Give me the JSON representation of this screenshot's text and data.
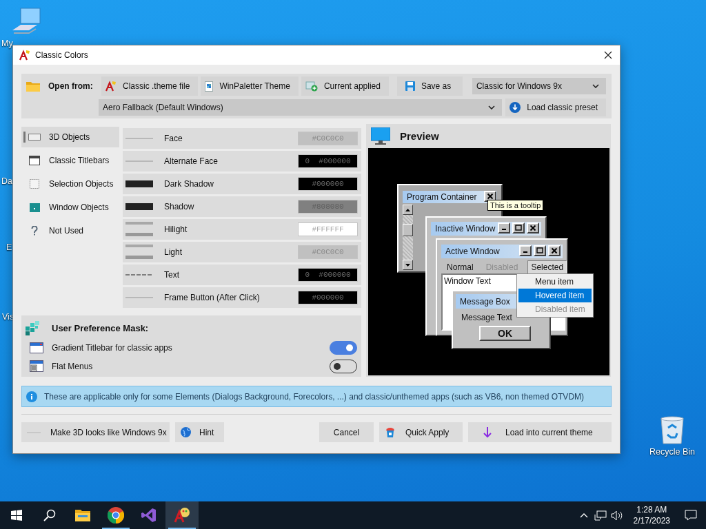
{
  "desktop_icons": [
    {
      "label": "My",
      "kind": "computer"
    },
    {
      "label": "Da",
      "kind": "hidden"
    },
    {
      "label": "E",
      "kind": "hidden"
    },
    {
      "label": "Vis",
      "kind": "hidden"
    },
    {
      "label": "Recycle Bin",
      "kind": "recycle"
    }
  ],
  "window": {
    "title": "Classic Colors"
  },
  "toolbar": {
    "open_label": "Open from:",
    "sources": [
      {
        "label": "Classic .theme file",
        "kind": "theme"
      },
      {
        "label": "WinPaletter Theme",
        "kind": "palette"
      },
      {
        "label": "Current applied",
        "kind": "applied"
      }
    ],
    "save_as": "Save as",
    "format": "Classic for Windows 9x",
    "preset": "Aero Fallback (Default Windows)",
    "load_preset": "Load classic preset"
  },
  "categories": [
    {
      "label": "3D Objects",
      "kind": "objects",
      "selected": true
    },
    {
      "label": "Classic Titlebars",
      "kind": "titlebar",
      "selected": false
    },
    {
      "label": "Selection Objects",
      "kind": "selection",
      "selected": false
    },
    {
      "label": "Window Objects",
      "kind": "window",
      "selected": false
    },
    {
      "label": "Not Used",
      "kind": "unknown",
      "selected": false
    }
  ],
  "colors": [
    {
      "name": "Face",
      "kind": "line",
      "value": "#C0C0C0",
      "color": "#c0c0c0"
    },
    {
      "name": "Alternate Face",
      "kind": "line",
      "value": "0  #000000",
      "color": "#000000"
    },
    {
      "name": "Dark Shadow",
      "kind": "bar",
      "value": "#000000",
      "color": "#000000"
    },
    {
      "name": "Shadow",
      "kind": "bar",
      "value": "#808080",
      "color": "#808080"
    },
    {
      "name": "Hilight",
      "kind": "double",
      "value": "#FFFFFF",
      "color": "#ffffff"
    },
    {
      "name": "Light",
      "kind": "double",
      "value": "#C0C0C0",
      "color": "#c0c0c0"
    },
    {
      "name": "Text",
      "kind": "dashed",
      "value": "0  #000000",
      "color": "#000000"
    },
    {
      "name": "Frame Button (After Click)",
      "kind": "line",
      "value": "#000000",
      "color": "#000000"
    }
  ],
  "preview": {
    "title": "Preview",
    "program_container": {
      "title": "Program Container"
    },
    "tooltip": "This is a tooltip",
    "inactive_window": {
      "title": "Inactive Window"
    },
    "active_window": {
      "title": "Active Window",
      "menu": [
        {
          "label": "Normal",
          "disabled": false,
          "selected": false
        },
        {
          "label": "Disabled",
          "disabled": true,
          "selected": false
        },
        {
          "label": "Selected",
          "disabled": false,
          "selected": true
        }
      ],
      "text": "Window Text"
    },
    "popup_menu": [
      {
        "label": "Menu item",
        "hovered": false,
        "disabled": false
      },
      {
        "label": "Hovered item",
        "hovered": true,
        "disabled": false
      },
      {
        "label": "Disabled item",
        "hovered": false,
        "disabled": true
      }
    ],
    "message_box": {
      "title": "Message Box",
      "text": "Message Text",
      "button": "OK"
    }
  },
  "preferences": {
    "title": "User Preference Mask:",
    "items": [
      {
        "label": "Gradient Titlebar for classic apps",
        "kind": "gradient",
        "on": true
      },
      {
        "label": "Flat Menus",
        "kind": "menu",
        "on": false
      }
    ]
  },
  "info": "These are applicable only for some Elements (Dialogs Background, Forecolors, ...) and classic/unthemed apps (such as VB6, non themed OTVDM)",
  "footer": {
    "make_9x": "Make 3D looks like Windows 9x",
    "hint": "Hint",
    "cancel": "Cancel",
    "quick_apply": "Quick Apply",
    "load": "Load into current theme"
  },
  "taskbar": {
    "apps": [
      {
        "kind": "folder",
        "running": false,
        "selected": false
      },
      {
        "kind": "browser",
        "running": true,
        "selected": false
      },
      {
        "kind": "studio",
        "running": false,
        "selected": false
      },
      {
        "kind": "palette",
        "running": true,
        "selected": true
      }
    ],
    "time": "1:28 AM",
    "date": "2/17/2023"
  }
}
